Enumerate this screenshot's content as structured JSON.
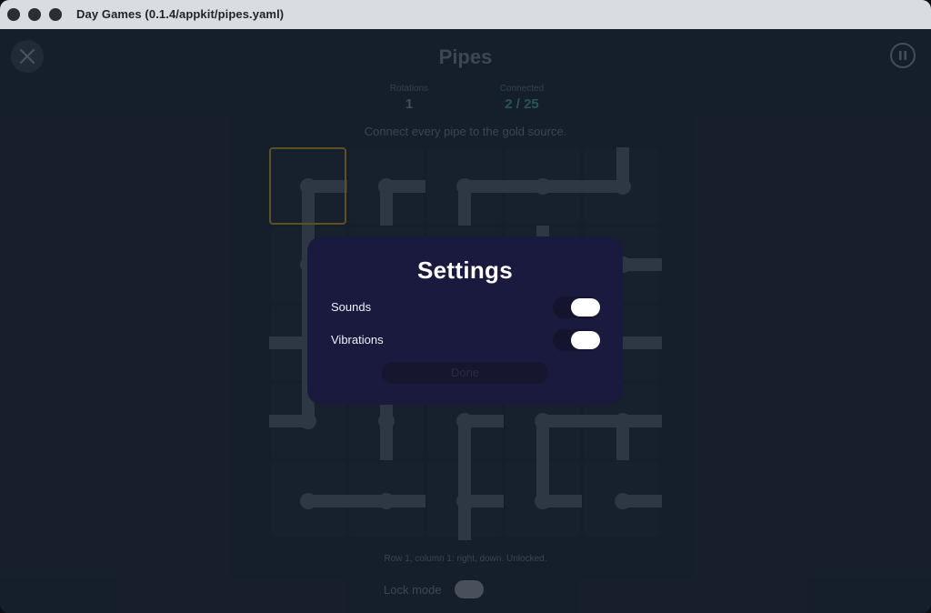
{
  "window": {
    "title": "Day Games (0.1.4/appkit/pipes.yaml)"
  },
  "game": {
    "title": "Pipes",
    "stats": {
      "rotations_label": "Rotations",
      "rotations_value": "1",
      "connected_label": "Connected",
      "connected_value": "2 / 25"
    },
    "instructions": "Connect every pipe to the gold source.",
    "status": "Row 1, column 1: right, down. Unlocked.",
    "lock_mode_label": "Lock mode",
    "lock_mode_on": false
  },
  "settings": {
    "title": "Settings",
    "rows": [
      {
        "label": "Sounds",
        "on": true
      },
      {
        "label": "Vibrations",
        "on": true
      }
    ],
    "done_label": "Done"
  },
  "icons": {
    "close": "close-icon",
    "pause": "pause-icon"
  },
  "colors": {
    "accent_connected": "#2b6f6a",
    "selection_gold": "#7a6324",
    "modal_bg": "#1a1a3e"
  }
}
